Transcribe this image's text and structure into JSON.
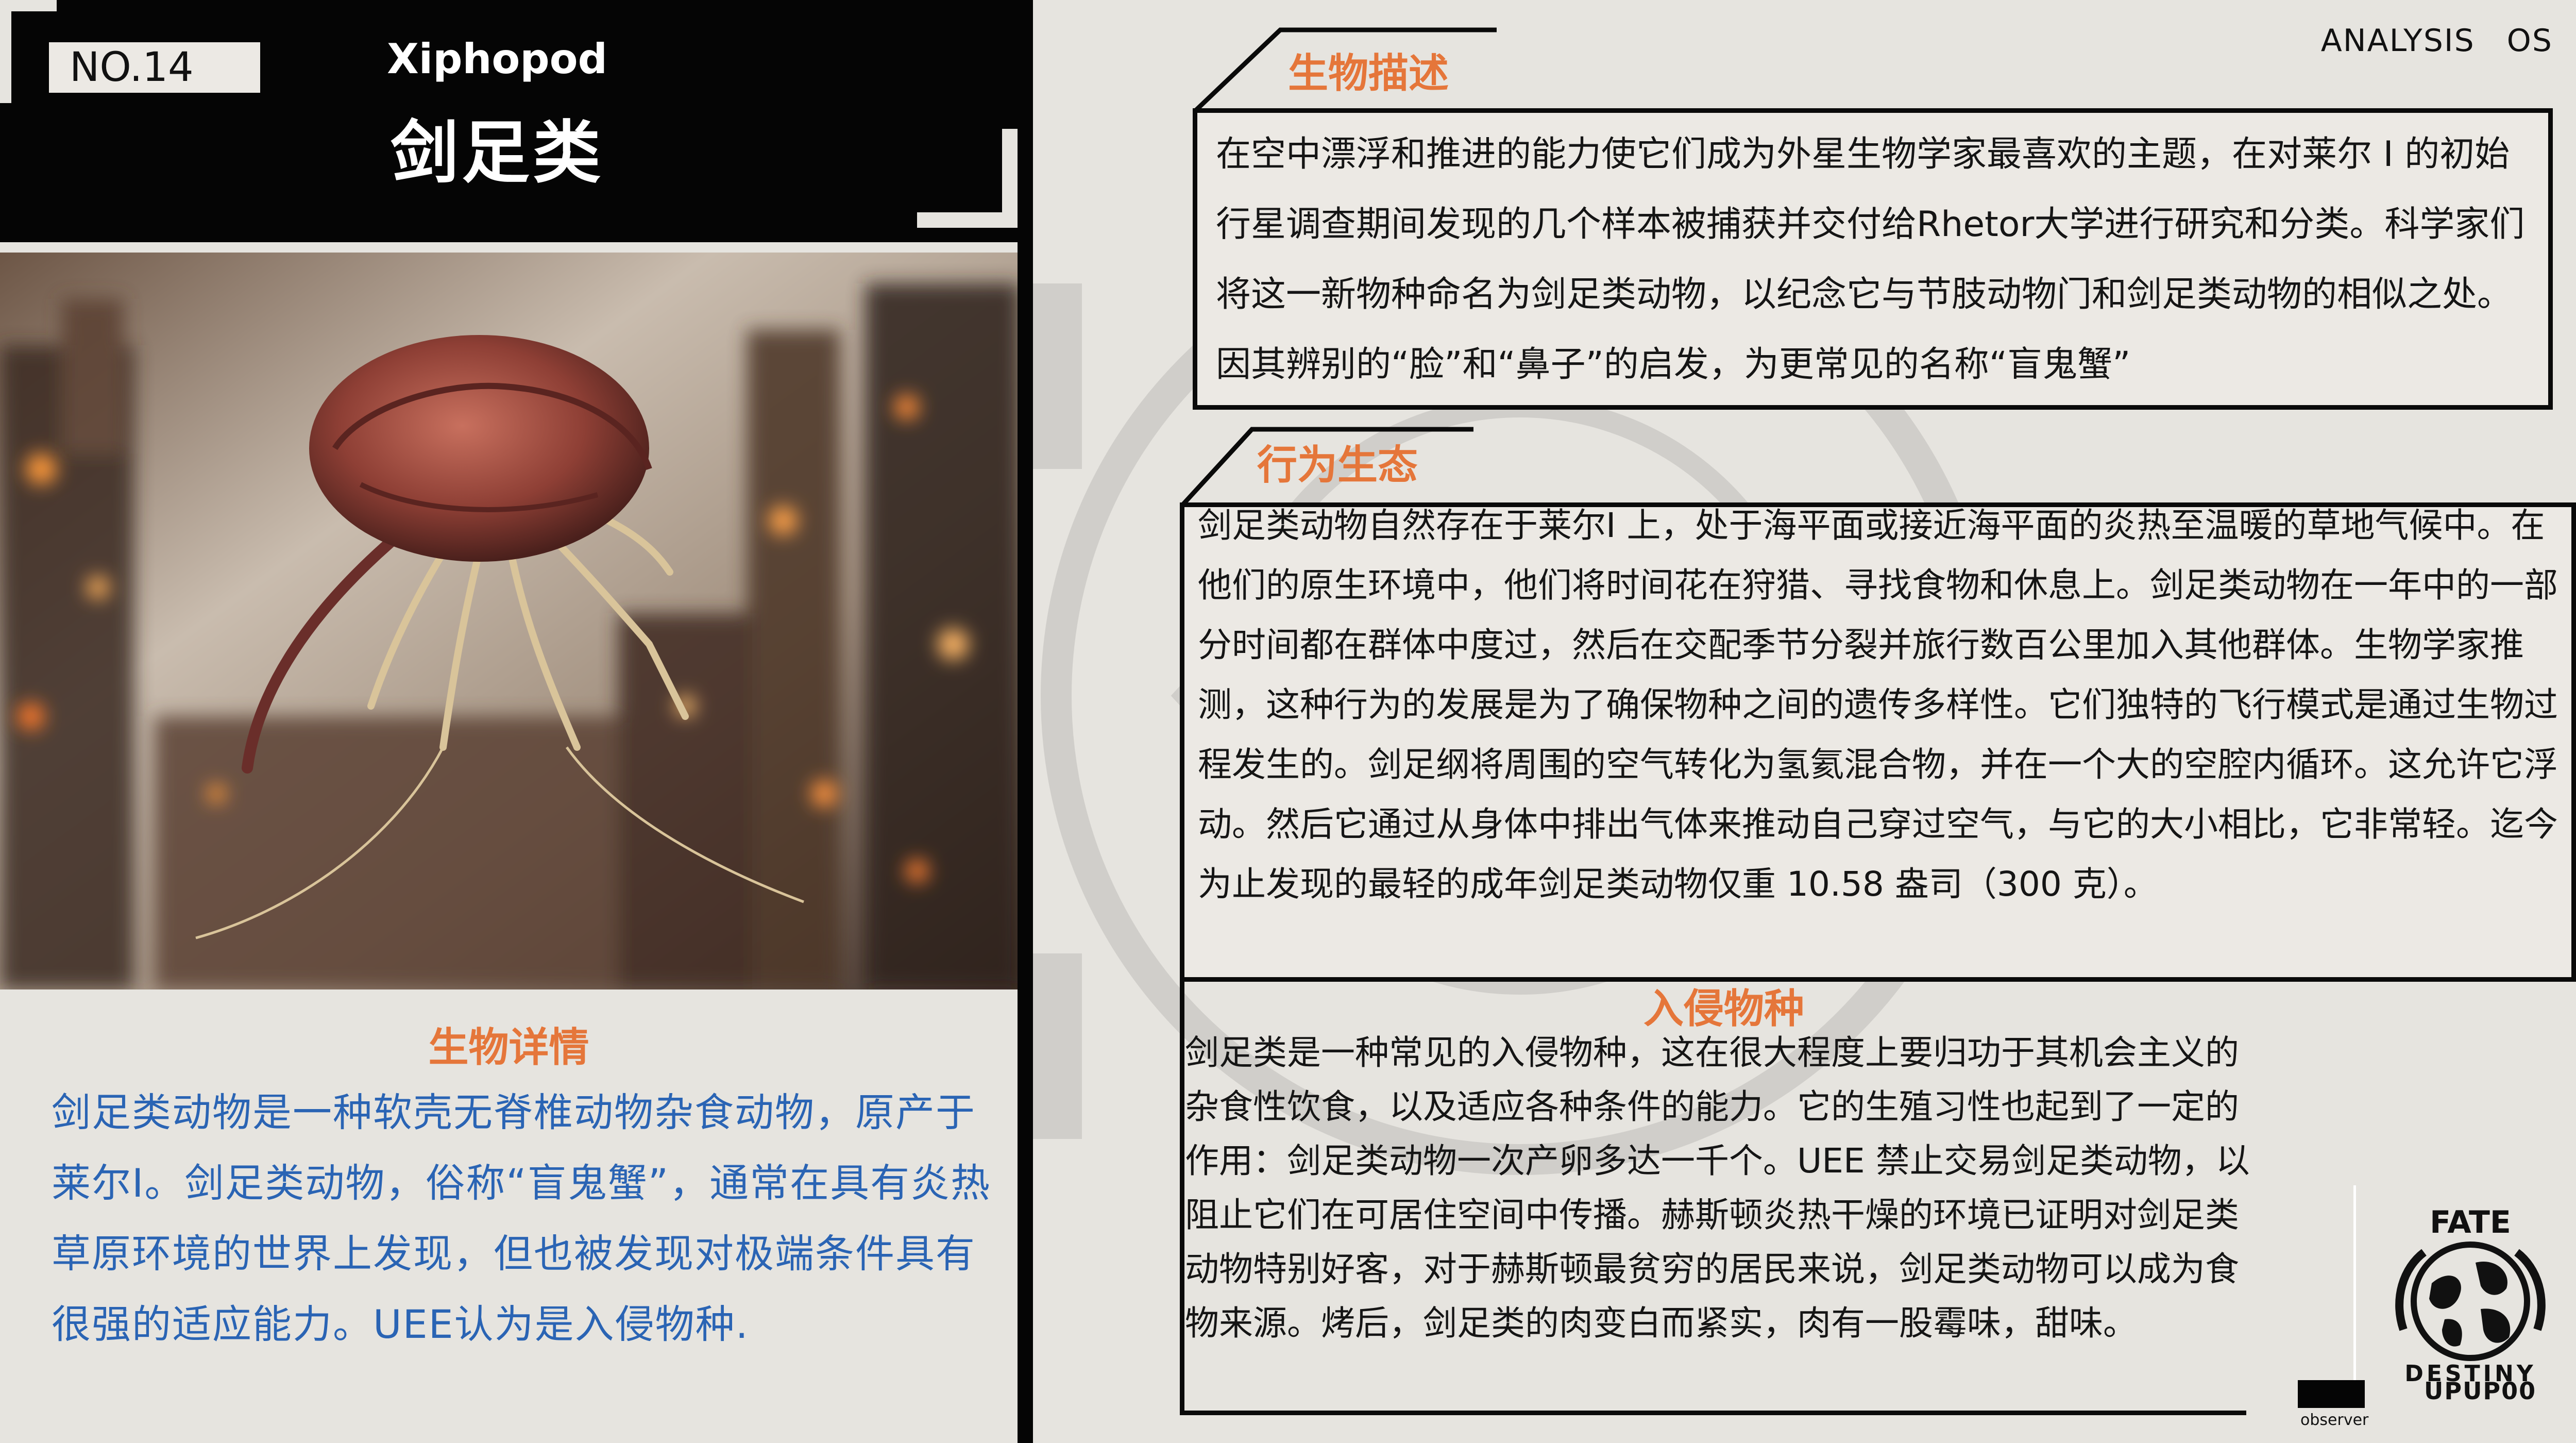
{
  "card": {
    "number": "NO.14",
    "name_en": "Xiphopod",
    "name_cn": "剑足类"
  },
  "details": {
    "title": "生物详情",
    "text": "剑足类动物是一种软壳无脊椎动物杂食动物，原产于莱尔I。剑足类动物，俗称“盲鬼蟹”，通常在具有炎热草原环境的世界上发现，但也被发现对极端条件具有很强的适应能力。UEE认为是入侵物种."
  },
  "header": {
    "label": "ANALYSIS　OS"
  },
  "description": {
    "title": "生物描述",
    "text": "在空中漂浮和推进的能力使它们成为外星生物学家最喜欢的主题，在对莱尔 I 的初始行星调查期间发现的几个样本被捕获并交付给Rhetor大学进行研究和分类。科学家们将这一新物种命名为剑足类动物，以纪念它与节肢动物门和剑足类动物的相似之处。因其辨别的“脸”和“鼻子”的启发，为更常见的名称“盲鬼蟹”"
  },
  "behavior": {
    "title": "行为生态",
    "text": "剑足类动物自然存在于莱尔I 上，处于海平面或接近海平面的炎热至温暖的草地气候中。在他们的原生环境中，他们将时间花在狩猎、寻找食物和休息上。剑足类动物在一年中的一部分时间都在群体中度过，然后在交配季节分裂并旅行数百公里加入其他群体。生物学家推测，这种行为的发展是为了确保物种之间的遗传多样性。它们独特的飞行模式是通过生物过程发生的。剑足纲将周围的空气转化为氢氦混合物，并在一个大的空腔内循环。这允许它浮动。然后它通过从身体中排出气体来推动自己穿过空气，与它的大小相比，它非常轻。迄今为止发现的最轻的成年剑足类动物仅重 10.58 盎司（300 克）。"
  },
  "invasive": {
    "title": "入侵物种",
    "text": "剑足类是一种常见的入侵物种，这在很大程度上要归功于其机会主义的杂食性饮食，以及适应各种条件的能力。它的生殖习性也起到了一定的作用：剑足类动物一次产卵多达一千个。UEE 禁止交易剑足类动物，以阻止它们在可居住空间中传播。赫斯顿炎热干燥的环境已证明对剑足类动物特别好客，对于赫斯顿最贫穷的居民来说，剑足类动物可以成为食物来源。烤后，剑足类的肉变白而紧实，肉有一股霉味，甜味。"
  },
  "branding": {
    "logo_top": "FATE",
    "logo_bottom": "DESTINY",
    "tag": "UPUP00",
    "observer": "observer"
  },
  "colors": {
    "accent_orange": "#e5763a",
    "details_blue": "#2a64b4",
    "band_black": "#050505",
    "paper": "#e6e4df"
  },
  "icons": {
    "logo": "globe-laurel-emblem-icon",
    "watermark": "circular-emblem-watermark-icon"
  }
}
